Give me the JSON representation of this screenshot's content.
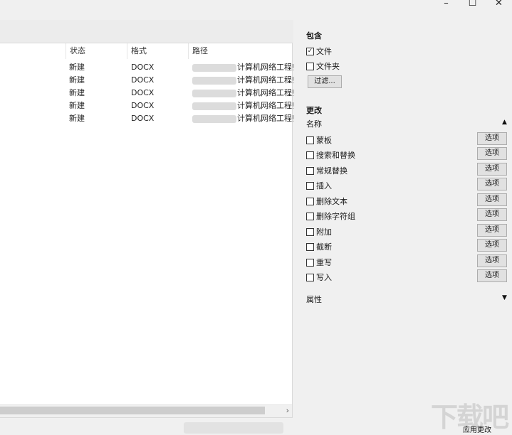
{
  "window": {
    "min_glyph": "–",
    "max_glyph": "☐",
    "close_glyph": "✕"
  },
  "filelist": {
    "columns": [
      "状态",
      "格式",
      "路径"
    ],
    "rows": [
      {
        "status": "新建",
        "format": "DOCX",
        "path": "计算机网络工程师"
      },
      {
        "status": "新建",
        "format": "DOCX",
        "path": "计算机网络工程师"
      },
      {
        "status": "新建",
        "format": "DOCX",
        "path": "计算机网络工程师"
      },
      {
        "status": "新建",
        "format": "DOCX",
        "path": "计算机网络工程师"
      },
      {
        "status": "新建",
        "format": "DOCX",
        "path": "计算机网络工程师"
      }
    ],
    "scroll_right_glyph": "›"
  },
  "include": {
    "title": "包含",
    "file_label": "文件",
    "file_checked": "✓",
    "folder_label": "文件夹",
    "filter_button": "过滤..."
  },
  "change": {
    "title": "更改",
    "name_header": "名称",
    "items": [
      "蒙板",
      "搜索和替换",
      "常规替换",
      "插入",
      "删除文本",
      "删除字符组",
      "附加",
      "截断",
      "重写",
      "写入"
    ],
    "option_label": "选项",
    "attributes_label": "属性",
    "expand_up_glyph": "▲",
    "expand_down_glyph": "▼"
  },
  "footer": {
    "apply_label": "应用更改",
    "watermark": "下载吧"
  }
}
